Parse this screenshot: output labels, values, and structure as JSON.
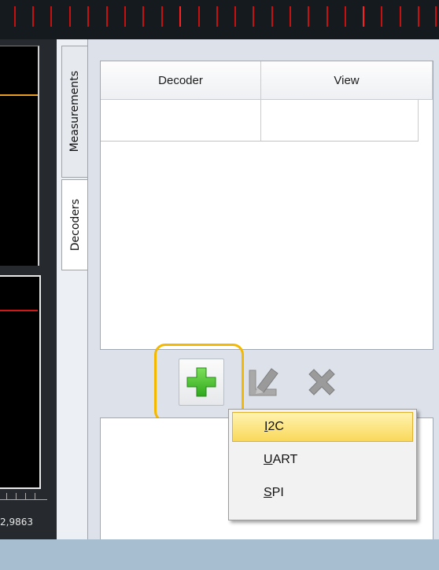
{
  "tabs": {
    "measurements": "Measurements",
    "decoders": "Decoders"
  },
  "table": {
    "columns": [
      "Decoder",
      "View"
    ],
    "rows": [
      [
        "",
        ""
      ]
    ]
  },
  "scope": {
    "coordinate_readout": "2,9863"
  },
  "toolbar": {
    "add_icon": "plus-icon",
    "edit_icon": "edit-icon",
    "delete_icon": "delete-x-icon"
  },
  "add_menu": {
    "items": [
      "I2C",
      "UART",
      "SPI"
    ],
    "selected": "I2C",
    "mnemonics": [
      "I",
      "U",
      "S"
    ]
  },
  "colors": {
    "highlight": "#f4b800",
    "menu_selection": "#f9d85a",
    "add_icon": "#3fbf2a",
    "status_bar": "#a7bed0"
  }
}
